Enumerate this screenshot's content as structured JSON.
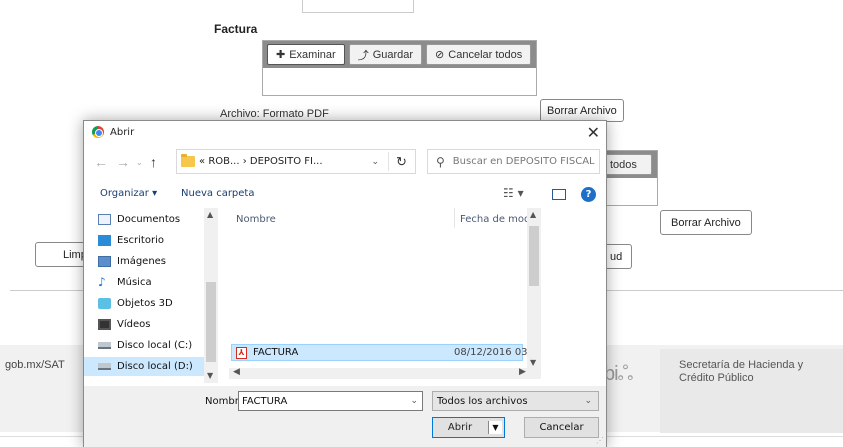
{
  "page": {
    "factura_title": "Factura",
    "toolbar1": {
      "examinar": "Examinar",
      "guardar": "Guardar",
      "cancelar_todos": "Cancelar todos"
    },
    "archivo_label": "Archivo: Formato PDF",
    "borrar_archivo_1": "Borrar Archivo",
    "toolbar2_partial": "todos",
    "borrar_archivo_2": "Borrar Archivo",
    "limpiar_partial": "Limpi",
    "ud_partial": "ud",
    "footer": {
      "sat_link": "gob.mx/SAT",
      "shcp_line1": "Secretaría de Hacienda y",
      "shcp_line2": "Crédito Público",
      "logo_fragment": "bi"
    }
  },
  "dialog": {
    "title": "Abrir",
    "address": {
      "prefix": "«",
      "path1": "ROB...",
      "separator": "›",
      "path2": "DEPOSITO FI..."
    },
    "search_placeholder": "Buscar en DEPOSITO FISCAL",
    "organize": "Organizar ▾",
    "new_folder": "Nueva carpeta",
    "nav_items": [
      {
        "label": "Documentos",
        "icon": "documents-icon"
      },
      {
        "label": "Escritorio",
        "icon": "desktop-icon"
      },
      {
        "label": "Imágenes",
        "icon": "pictures-icon"
      },
      {
        "label": "Música",
        "icon": "music-icon"
      },
      {
        "label": "Objetos 3D",
        "icon": "3d-objects-icon"
      },
      {
        "label": "Vídeos",
        "icon": "videos-icon"
      },
      {
        "label": "Disco local (C:)",
        "icon": "drive-c-icon"
      },
      {
        "label": "Disco local (D:)",
        "icon": "drive-d-icon"
      }
    ],
    "columns": {
      "name": "Nombre",
      "date": "Fecha de mod"
    },
    "files": [
      {
        "name": "FACTURA",
        "date": "08/12/2016 03:"
      }
    ],
    "filename_label": "Nombre:",
    "filename_value": "FACTURA",
    "filter_value": "Todos los archivos",
    "open_label": "Abrir",
    "cancel_label": "Cancelar"
  }
}
